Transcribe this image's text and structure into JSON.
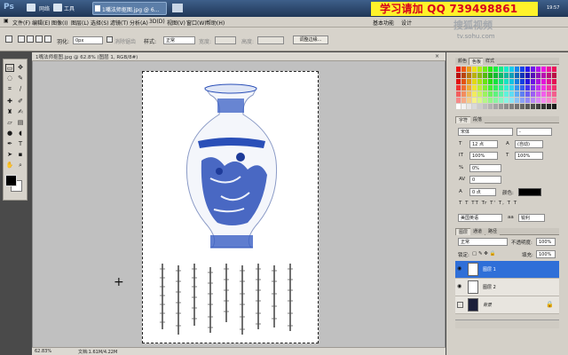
{
  "title_bar": {
    "app_logo": "Ps",
    "menus": [
      "网络",
      "工具"
    ],
    "task_tab": "1嘴法师抠图.jpg @ 6…",
    "ad_text": "学习请加 QQ 739498861",
    "clock": "19:57"
  },
  "menubar": {
    "items": [
      "文件(F)",
      "编辑(E)",
      "图像(I)",
      "图层(L)",
      "选择(S)",
      "滤镜(T)",
      "分析(A)",
      "3D(D)",
      "视图(V)",
      "窗口(W)",
      "帮助(H)"
    ],
    "right_tabs": [
      "基本功能",
      "设计"
    ]
  },
  "options": {
    "feather_label": "羽化:",
    "feather_value": "0px",
    "antialias_label": "消除锯齿",
    "style_label": "样式:",
    "style_value": "正常",
    "width_label": "宽度:",
    "height_label": "高度:",
    "refine_label": "调整边缘..."
  },
  "watermark": {
    "logo": "搜狐视频",
    "url": "tv.sohu.com"
  },
  "document": {
    "tab_title": "1嘴法师抠图.jpg @ 62.8% (图层 1, RGB/8#)",
    "zoom": "62.83%",
    "doc_size": "文档:1.61M/4.22M"
  },
  "panels": {
    "color_tabs": [
      "颜色",
      "色板",
      "样式"
    ],
    "char_tabs": [
      "字符",
      "段落"
    ],
    "font_family": "宋体",
    "font_style": "-",
    "font_size": "12 点",
    "leading": "(自动)",
    "vscale": "100%",
    "hscale": "100%",
    "tracking": "0%",
    "kerning": "0",
    "baseline": "0 点",
    "color_label": "颜色:",
    "language": "美国英语",
    "aa_label": "aa",
    "aa_value": "锐利",
    "layer_tabs": [
      "图层",
      "通道",
      "路径"
    ],
    "blend_mode": "正常",
    "opacity_label": "不透明度:",
    "opacity_value": "100%",
    "lock_label": "锁定:",
    "fill_label": "填充:",
    "fill_value": "100%",
    "layers": [
      {
        "name": "图层 1",
        "selected": true
      },
      {
        "name": "图层 2",
        "selected": false
      },
      {
        "name": "背景",
        "selected": false
      }
    ]
  },
  "colors": {
    "ad_bg": "#fff22a",
    "ad_fg": "#d6001c",
    "selection": "#2f6fd8",
    "vase_blue": "#2a4fb8"
  }
}
